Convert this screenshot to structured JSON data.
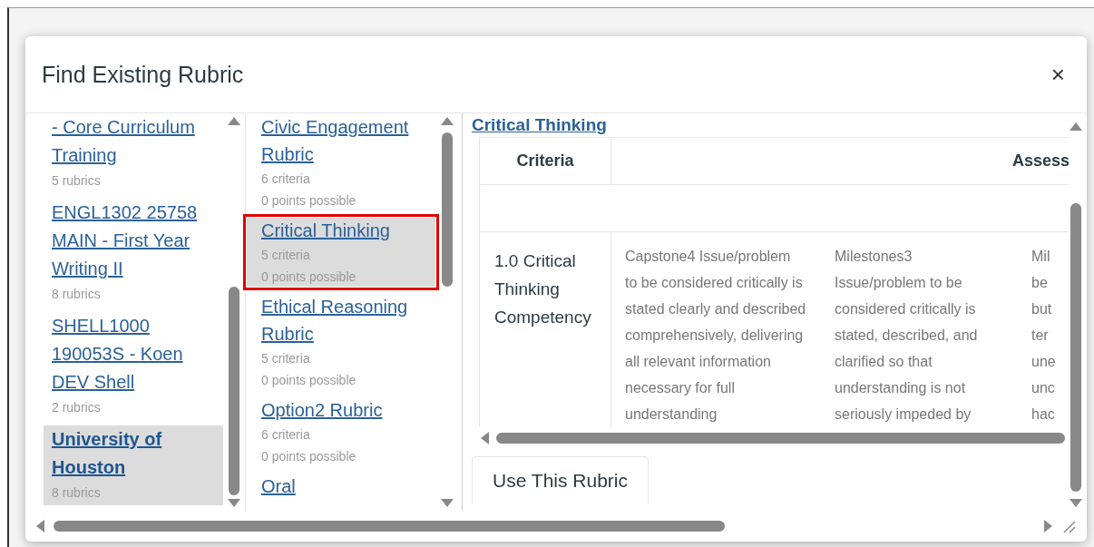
{
  "dialog": {
    "title": "Find Existing Rubric",
    "close": "×"
  },
  "contexts": [
    {
      "name": "- Core Curriculum Training",
      "count": "5 rubrics",
      "selected": false
    },
    {
      "name": "ENGL1302 25758 MAIN - First Year Writing II",
      "count": "8 rubrics",
      "selected": false
    },
    {
      "name": "SHELL1000 190053S - Koen DEV Shell",
      "count": "2 rubrics",
      "selected": false
    },
    {
      "name": "University of Houston",
      "count": "8 rubrics",
      "selected": true
    }
  ],
  "rubrics": [
    {
      "title": "Civic Engagement Rubric",
      "criteria": "6 criteria",
      "points": "0 points possible",
      "selected": false,
      "outlined": false
    },
    {
      "title": "Critical Thinking",
      "criteria": "5 criteria",
      "points": "0 points possible",
      "selected": true,
      "outlined": true
    },
    {
      "title": "Ethical Reasoning Rubric",
      "criteria": "5 criteria",
      "points": "0 points possible",
      "selected": false,
      "outlined": false
    },
    {
      "title": "Option2 Rubric",
      "criteria": "6 criteria",
      "points": "0 points possible",
      "selected": false,
      "outlined": false
    },
    {
      "title": "Oral"
    }
  ],
  "preview": {
    "title": "Critical Thinking",
    "columns": [
      "Criteria",
      "Assess"
    ],
    "rows": [
      {
        "criterion": "1.0 Critical Thinking Competency",
        "ratings": [
          [
            "Capstone4 Issue/problem",
            "to be considered critically is",
            "stated clearly and described",
            "comprehensively, delivering",
            "all relevant information",
            "necessary for full",
            "understanding"
          ],
          [
            "Milestones3",
            "Issue/problem to be",
            "considered critically is",
            "stated, described, and",
            "clarified so that",
            "understanding is not",
            "seriously impeded by"
          ],
          [
            "Mil",
            "be",
            "but",
            "ter",
            "une",
            "unc",
            "hac"
          ]
        ]
      }
    ]
  },
  "use_button": "Use This Rubric"
}
